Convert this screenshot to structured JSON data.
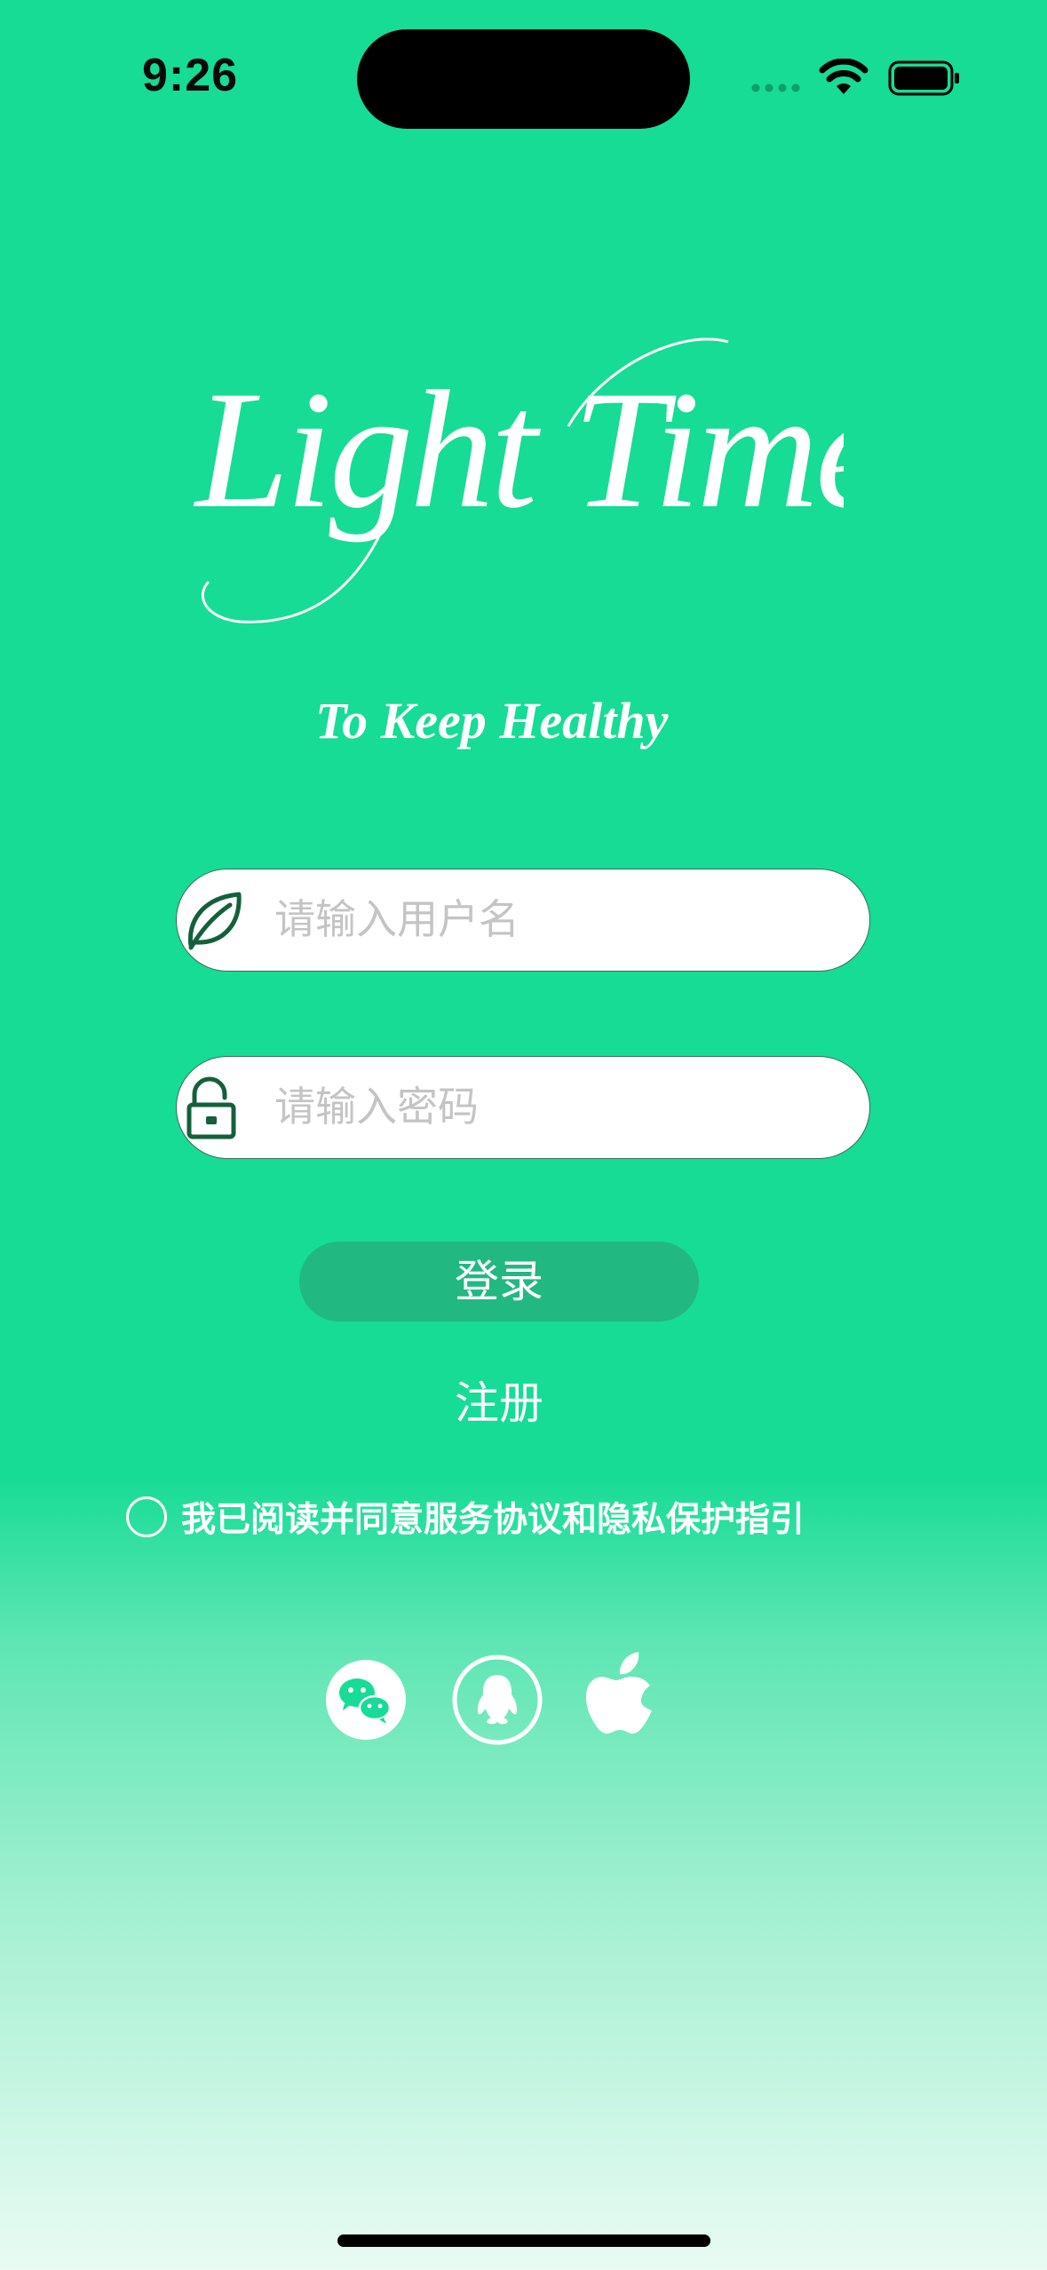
{
  "status_bar": {
    "time": "9:26",
    "icons": [
      "signal-dots-icon",
      "wifi-icon",
      "battery-icon"
    ]
  },
  "brand": {
    "logo_text": "Light Time",
    "tagline": "To Keep Healthy"
  },
  "form": {
    "username_placeholder": "请输入用户名",
    "username_icon": "leaf-icon",
    "password_placeholder": "请输入密码",
    "password_icon": "unlock-icon",
    "login_label": "登录",
    "register_label": "注册",
    "agreement_text": "我已阅读并同意服务协议和隐私保护指引",
    "agreement_checked": false
  },
  "social_login": [
    {
      "icon": "wechat-icon"
    },
    {
      "icon": "qq-icon"
    },
    {
      "icon": "apple-icon"
    }
  ],
  "colors": {
    "background": "#16dc95",
    "button": "#22b882",
    "icon_dark_green": "#14603c",
    "text": "#ffffff"
  }
}
